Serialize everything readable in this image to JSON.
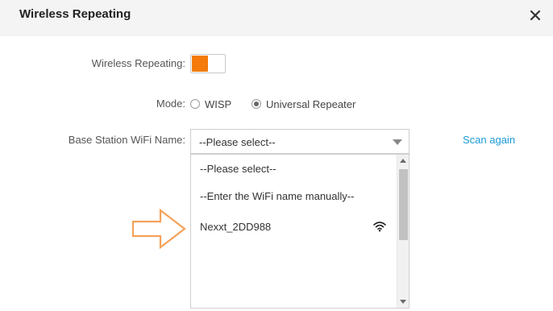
{
  "dialog": {
    "title": "Wireless Repeating",
    "close_icon": "close-icon"
  },
  "form": {
    "repeating_label": "Wireless Repeating:",
    "repeating_enabled": true,
    "mode_label": "Mode:",
    "mode_options": [
      {
        "label": "WISP",
        "selected": false
      },
      {
        "label": "Universal Repeater",
        "selected": true
      }
    ],
    "base_station_label": "Base Station WiFi Name:",
    "base_station_value": "--Please select--",
    "scan_again": "Scan again"
  },
  "dropdown": {
    "options": [
      {
        "label": "--Please select--"
      },
      {
        "label": "--Enter the WiFi name manually--"
      },
      {
        "label": "Nexxt_2DD988",
        "icon": "wifi-signal-icon"
      }
    ]
  },
  "colors": {
    "accent": "#f47b0b",
    "link": "#1a9ad6"
  }
}
